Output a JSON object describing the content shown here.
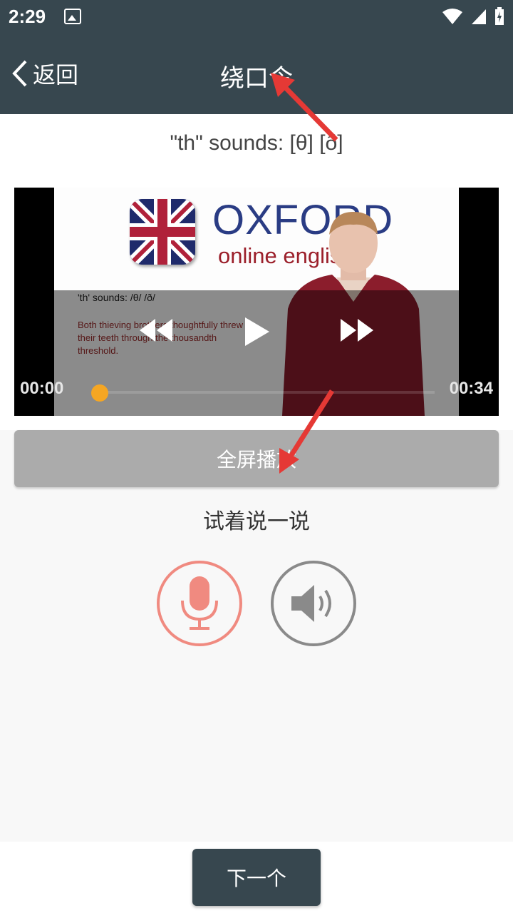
{
  "status_bar": {
    "time": "2:29"
  },
  "toolbar": {
    "back_label": "返回",
    "title": "绕口令"
  },
  "subtitle": "\"th\" sounds: [θ] [ð]",
  "video": {
    "brand": "OXFORD",
    "brand_sub": "online english",
    "slide_title": "'th' sounds: /θ/ /ð/",
    "slide_text": "Both thieving brothers thoughtfully threw their teeth through the thousandth threshold.",
    "current_time": "00:00",
    "duration": "00:34",
    "progress": 0
  },
  "fullscreen_label": "全屏播放",
  "try_label": "试着说一说",
  "next_label": "下一个",
  "colors": {
    "header": "#37474f",
    "accent": "#f5a623",
    "mic": "#f08a80",
    "speaker": "#8a8a8a",
    "arrow": "#e53935"
  }
}
